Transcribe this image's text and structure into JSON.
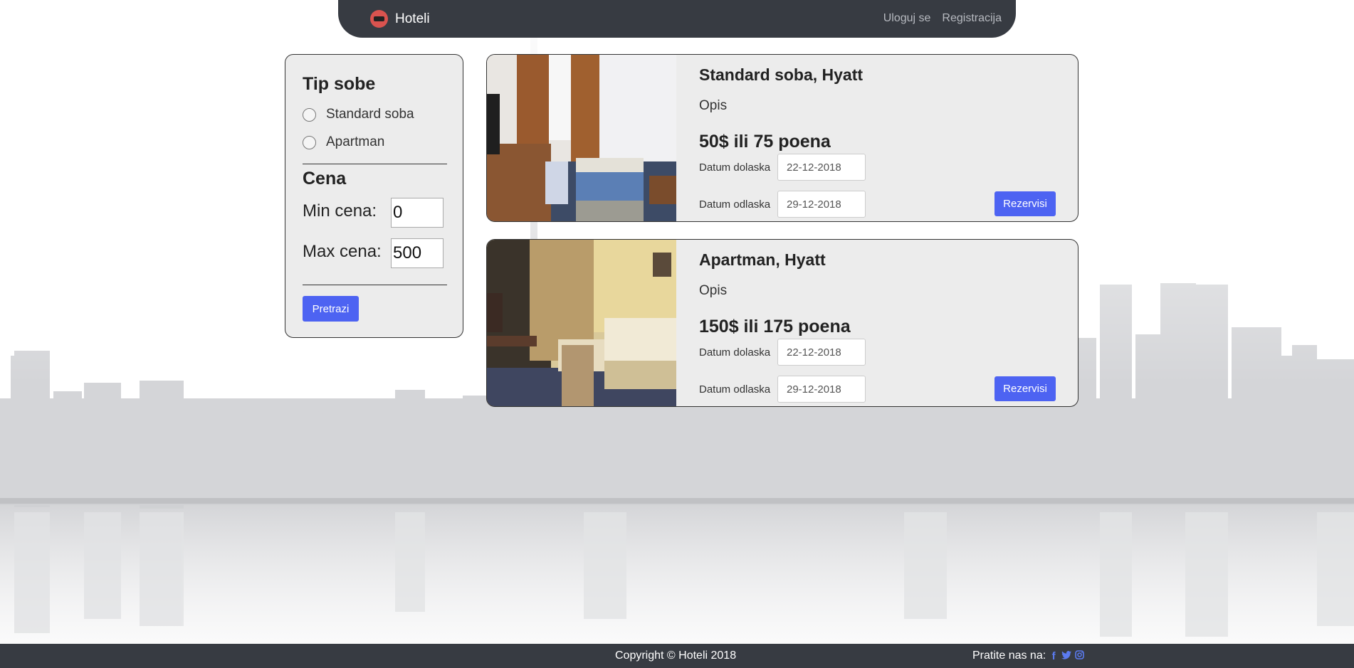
{
  "navbar": {
    "brand": "Hoteli",
    "links": [
      "Uloguj se",
      "Registracija"
    ]
  },
  "filter": {
    "room_type_title": "Tip sobe",
    "room_types": [
      "Standard soba",
      "Apartman"
    ],
    "price_title": "Cena",
    "min_label": "Min cena:",
    "min_value": "0",
    "max_label": "Max cena:",
    "max_value": "500",
    "search_button": "Pretrazi"
  },
  "rooms": [
    {
      "title": "Standard soba, Hyatt",
      "description": "Opis",
      "price": "50$ ili 75 poena",
      "arrival_label": "Datum dolaska",
      "arrival_value": "22-12-2018",
      "departure_label": "Datum odlaska",
      "departure_value": "29-12-2018",
      "book_button": "Rezervisi"
    },
    {
      "title": "Apartman, Hyatt",
      "description": "Opis",
      "price": "150$ ili 175 poena",
      "arrival_label": "Datum dolaska",
      "arrival_value": "22-12-2018",
      "departure_label": "Datum odlaska",
      "departure_value": "29-12-2018",
      "book_button": "Rezervisi"
    }
  ],
  "footer": {
    "copyright": "Copyright © Hoteli 2018",
    "follow": "Pratite nas na:",
    "social_icons": [
      "facebook-icon",
      "twitter-icon",
      "instagram-icon"
    ]
  },
  "colors": {
    "navbar": "#373b42",
    "accent_button": "#4d63f2",
    "panel": "#ececec"
  }
}
